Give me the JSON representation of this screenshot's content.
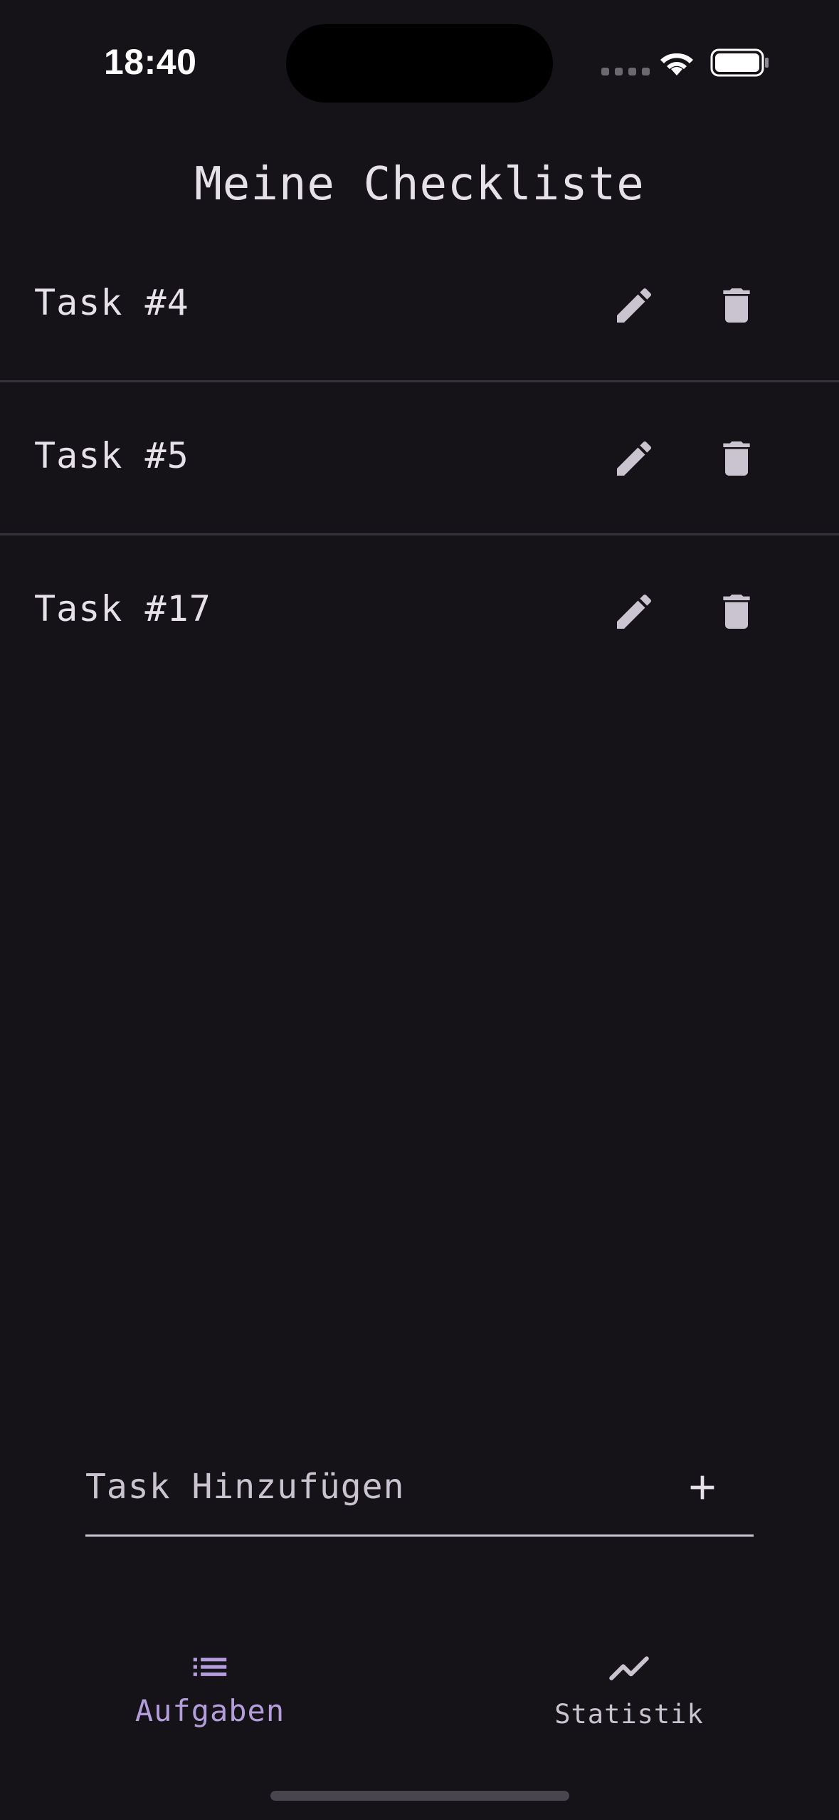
{
  "status_bar": {
    "time": "18:40"
  },
  "header": {
    "title": "Meine Checkliste"
  },
  "tasks": [
    {
      "label": "Task #4"
    },
    {
      "label": "Task #5"
    },
    {
      "label": "Task #17"
    }
  ],
  "add_task": {
    "placeholder": "Task Hinzufügen",
    "value": ""
  },
  "bottom_nav": {
    "items": [
      {
        "label": "Aufgaben",
        "icon": "list-icon",
        "active": true
      },
      {
        "label": "Statistik",
        "icon": "trending-icon",
        "active": false
      }
    ]
  },
  "colors": {
    "background": "#151218",
    "text": "#e6e0e9",
    "icon": "#cac4d0",
    "accent": "#b39ddb",
    "divider": "#36333b"
  }
}
